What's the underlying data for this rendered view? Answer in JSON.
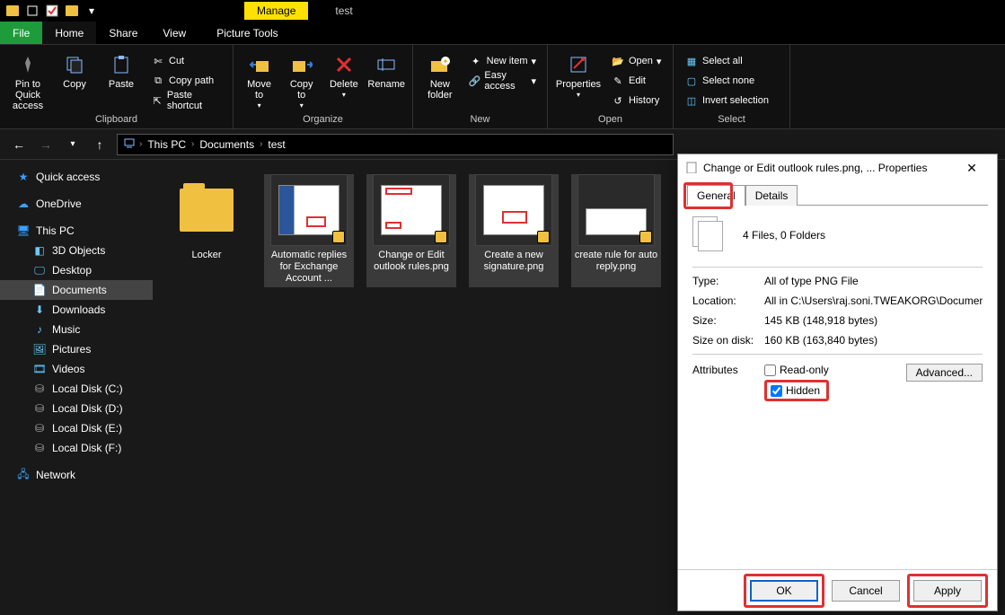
{
  "window": {
    "title": "test",
    "manage_tab": "Manage"
  },
  "tabs": {
    "file": "File",
    "home": "Home",
    "share": "Share",
    "view": "View",
    "picture_tools": "Picture Tools"
  },
  "ribbon": {
    "clipboard": {
      "label": "Clipboard",
      "pin": "Pin to Quick\naccess",
      "copy": "Copy",
      "paste": "Paste",
      "cut": "Cut",
      "copy_path": "Copy path",
      "paste_shortcut": "Paste shortcut"
    },
    "organize": {
      "label": "Organize",
      "move_to": "Move\nto",
      "copy_to": "Copy\nto",
      "delete": "Delete",
      "rename": "Rename"
    },
    "new": {
      "label": "New",
      "new_folder": "New\nfolder",
      "new_item": "New item",
      "easy_access": "Easy access"
    },
    "open": {
      "label": "Open",
      "properties": "Properties",
      "open": "Open",
      "edit": "Edit",
      "history": "History"
    },
    "select": {
      "label": "Select",
      "select_all": "Select all",
      "select_none": "Select none",
      "invert": "Invert selection"
    }
  },
  "breadcrumb": {
    "root": "This PC",
    "a": "Documents",
    "b": "test"
  },
  "sidebar": {
    "quick_access": "Quick access",
    "onedrive": "OneDrive",
    "this_pc": "This PC",
    "objects3d": "3D Objects",
    "desktop": "Desktop",
    "documents": "Documents",
    "downloads": "Downloads",
    "music": "Music",
    "pictures": "Pictures",
    "videos": "Videos",
    "disk_c": "Local Disk (C:)",
    "disk_d": "Local Disk (D:)",
    "disk_e": "Local Disk (E:)",
    "disk_f": "Local Disk (F:)",
    "network": "Network"
  },
  "files": {
    "f0": "Locker",
    "f1": "Automatic replies for Exchange Account ...",
    "f2": "Change or Edit outlook rules.png",
    "f3": "Create a new signature.png",
    "f4": "create rule for auto reply.png"
  },
  "dialog": {
    "title": "Change or Edit outlook rules.png, ... Properties",
    "tab_general": "General",
    "tab_details": "Details",
    "summary": "4 Files, 0 Folders",
    "type_k": "Type:",
    "type_v": "All of type PNG File",
    "loc_k": "Location:",
    "loc_v": "All in C:\\Users\\raj.soni.TWEAKORG\\Documents\\tes",
    "size_k": "Size:",
    "size_v": "145 KB (148,918 bytes)",
    "sod_k": "Size on disk:",
    "sod_v": "160 KB (163,840 bytes)",
    "attr_k": "Attributes",
    "readonly": "Read-only",
    "hidden": "Hidden",
    "advanced": "Advanced...",
    "ok": "OK",
    "cancel": "Cancel",
    "apply": "Apply"
  }
}
